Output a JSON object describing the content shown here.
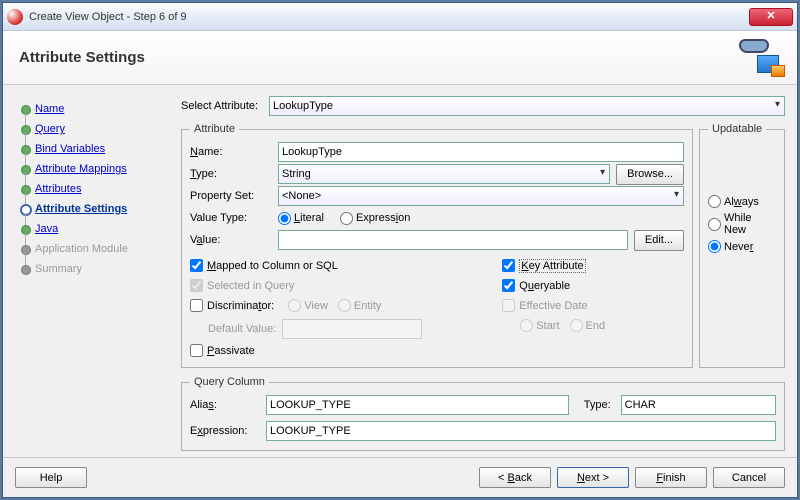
{
  "window": {
    "title": "Create View Object - Step 6 of 9"
  },
  "header": {
    "title": "Attribute Settings"
  },
  "nav": {
    "items": [
      {
        "label": "Name",
        "state": "done"
      },
      {
        "label": "Query",
        "state": "done"
      },
      {
        "label": "Bind Variables",
        "state": "done"
      },
      {
        "label": "Attribute Mappings",
        "state": "done"
      },
      {
        "label": "Attributes",
        "state": "done"
      },
      {
        "label": "Attribute Settings",
        "state": "current"
      },
      {
        "label": "Java",
        "state": "done"
      },
      {
        "label": "Application Module",
        "state": "disabled"
      },
      {
        "label": "Summary",
        "state": "disabled"
      }
    ]
  },
  "selectAttribute": {
    "label": "Select Attribute:",
    "value": "LookupType"
  },
  "attribute": {
    "legend": "Attribute",
    "name": {
      "label": "Name:",
      "value": "LookupType"
    },
    "type": {
      "label": "Type:",
      "value": "String",
      "browse": "Browse..."
    },
    "propertySet": {
      "label": "Property Set:",
      "value": "<None>"
    },
    "valueType": {
      "label": "Value Type:",
      "literal": "Literal",
      "expression": "Expression",
      "selected": "literal"
    },
    "value": {
      "label": "Value:",
      "value": "",
      "edit": "Edit..."
    },
    "checks": {
      "mapped": {
        "label": "Mapped to Column or SQL",
        "checked": true
      },
      "selectedInQuery": {
        "label": "Selected in Query",
        "checked": true,
        "disabled": true
      },
      "discriminator": {
        "label": "Discriminator:",
        "checked": false,
        "view": "View",
        "entity": "Entity"
      },
      "defaultValueLabel": "Default Value:",
      "passivate": {
        "label": "Passivate",
        "checked": false
      },
      "keyAttribute": {
        "label": "Key Attribute",
        "checked": true
      },
      "queryable": {
        "label": "Queryable",
        "checked": true
      },
      "effectiveDate": {
        "label": "Effective Date",
        "checked": false,
        "start": "Start",
        "end": "End"
      }
    }
  },
  "updatable": {
    "legend": "Updatable",
    "always": "Always",
    "whileNew": "While New",
    "never": "Never",
    "selected": "never"
  },
  "queryColumn": {
    "legend": "Query Column",
    "alias": {
      "label": "Alias:",
      "value": "LOOKUP_TYPE"
    },
    "type": {
      "label": "Type:",
      "value": "CHAR"
    },
    "expression": {
      "label": "Expression:",
      "value": "LOOKUP_TYPE"
    }
  },
  "footer": {
    "help": "Help",
    "back": "< Back",
    "next": "Next >",
    "finish": "Finish",
    "cancel": "Cancel"
  }
}
